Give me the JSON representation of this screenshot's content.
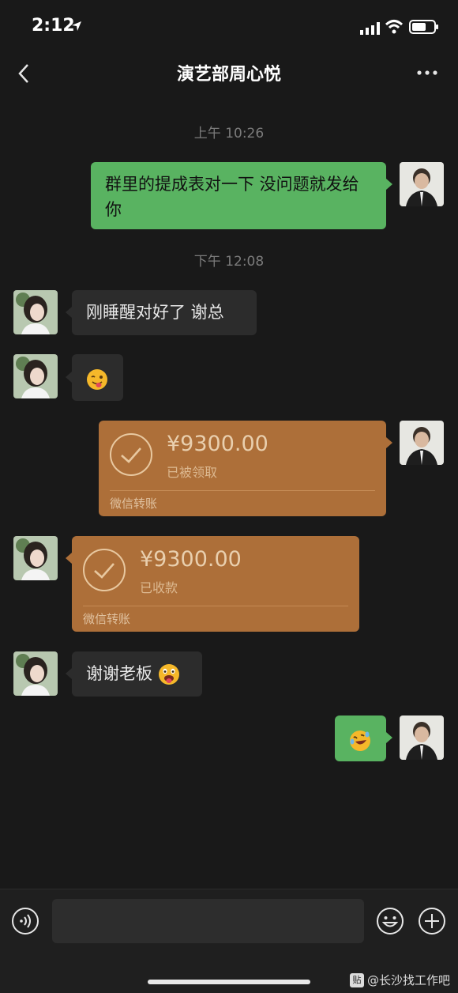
{
  "status_bar": {
    "time": "2:12"
  },
  "nav": {
    "title": "演艺部周心悦"
  },
  "messages": [
    {
      "type": "timestamp",
      "text": "上午 10:26"
    },
    {
      "type": "text",
      "side": "right",
      "text": "群里的提成表对一下 没问题就发给你"
    },
    {
      "type": "timestamp",
      "text": "下午 12:08"
    },
    {
      "type": "text",
      "side": "left",
      "text": "刚睡醒对好了 谢总"
    },
    {
      "type": "emoji",
      "side": "left",
      "emoji": "winking-tongue-emoji"
    },
    {
      "type": "transfer",
      "side": "right",
      "amount": "¥9300.00",
      "status": "已被领取",
      "label": "微信转账"
    },
    {
      "type": "transfer",
      "side": "left",
      "amount": "¥9300.00",
      "status": "已收款",
      "label": "微信转账"
    },
    {
      "type": "text",
      "side": "left",
      "text": "谢谢老板",
      "emoji": "tongue-out-emoji"
    },
    {
      "type": "emoji",
      "side": "right",
      "emoji": "laughing-tears-emoji"
    }
  ],
  "watermark": {
    "logo": "贴",
    "text": "@长沙找工作吧"
  },
  "colors": {
    "bubble_green": "#59b361",
    "bubble_dark": "#2c2c2c",
    "transfer": "#ad6f39",
    "background": "#191919"
  }
}
